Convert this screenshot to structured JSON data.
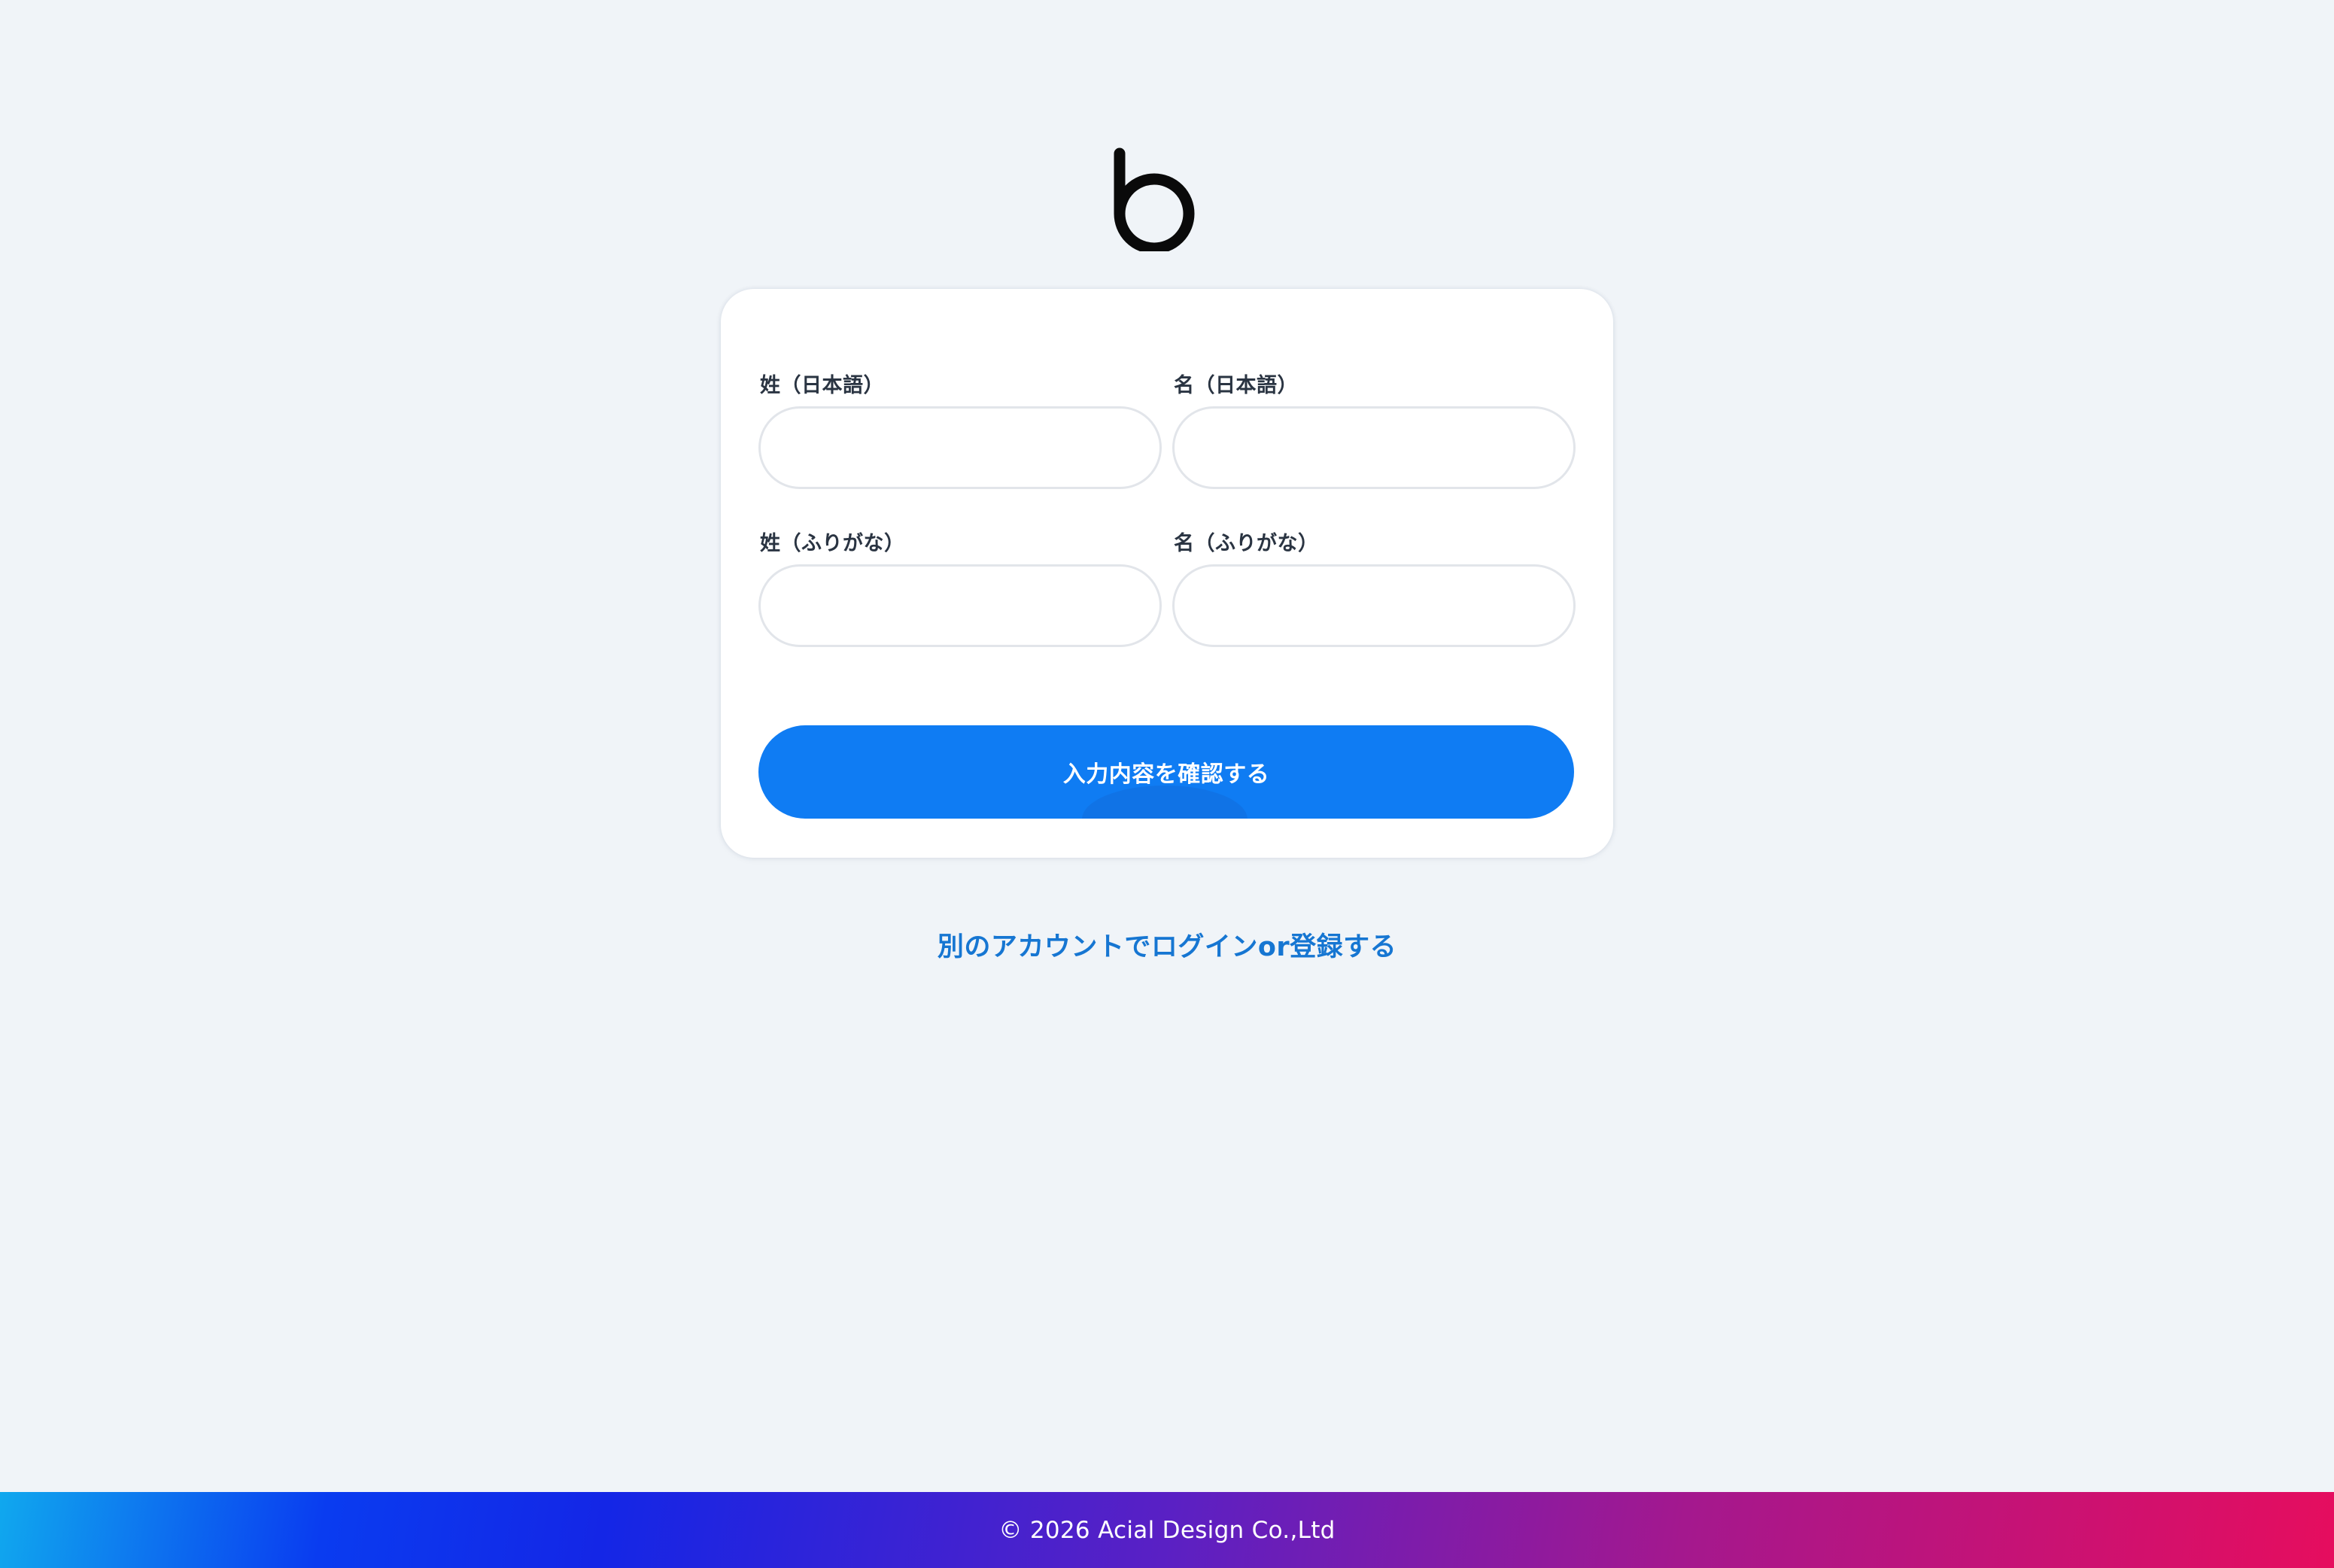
{
  "brand": {
    "logo_icon": "b-plus-logo-icon",
    "accent_blue": "#0f7cf3",
    "accent_magenta": "#e60d5e"
  },
  "form": {
    "last_name_jp_label": "姓（日本語）",
    "first_name_jp_label": "名（日本語）",
    "last_name_kana_label": "姓（ふりがな）",
    "first_name_kana_label": "名（ふりがな）",
    "last_name_jp_value": "",
    "first_name_jp_value": "",
    "last_name_kana_value": "",
    "first_name_kana_value": "",
    "submit_label": "入力内容を確認する"
  },
  "alt_link": {
    "label": "別のアカウントでログインor登録する"
  },
  "footer": {
    "copyright": "© 2026 Acial Design Co.,Ltd"
  }
}
